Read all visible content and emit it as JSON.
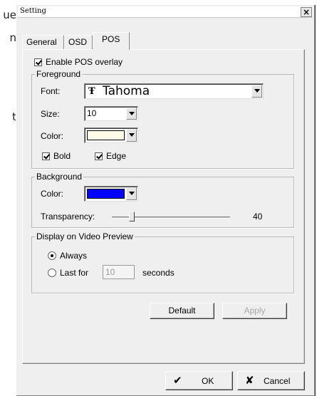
{
  "background": {
    "fragments": [
      "ue",
      "n",
      "t"
    ]
  },
  "dialog": {
    "title": "Setting",
    "close_glyph": "×",
    "tabs": [
      {
        "label": "General",
        "active": false
      },
      {
        "label": "OSD",
        "active": false
      },
      {
        "label": "POS",
        "active": true
      }
    ],
    "enable_pos_overlay": {
      "label": "Enable POS overlay",
      "checked": true
    },
    "foreground": {
      "title": "Foreground",
      "font_label": "Font:",
      "font_value": "Tahoma",
      "font_icon": "truetype-font-icon",
      "size_label": "Size:",
      "size_value": "10",
      "color_label": "Color:",
      "color_value": "#fffbe6",
      "bold": {
        "label": "Bold",
        "checked": true
      },
      "edge": {
        "label": "Edge",
        "checked": true
      }
    },
    "background_group": {
      "title": "Background",
      "color_label": "Color:",
      "color_value": "#0000ff",
      "transparency_label": "Transparency:",
      "transparency_value": "40",
      "transparency_fraction": 0.4
    },
    "display": {
      "title": "Display on Video Preview",
      "always_label": "Always",
      "last_for_label": "Last for",
      "seconds_value": "10",
      "seconds_label": "seconds",
      "selected": "always"
    },
    "buttons": {
      "default_label": "Default",
      "apply_label": "Apply",
      "ok_label": "OK",
      "ok_icon": "✔",
      "cancel_label": "Cancel",
      "cancel_icon": "✘"
    }
  }
}
